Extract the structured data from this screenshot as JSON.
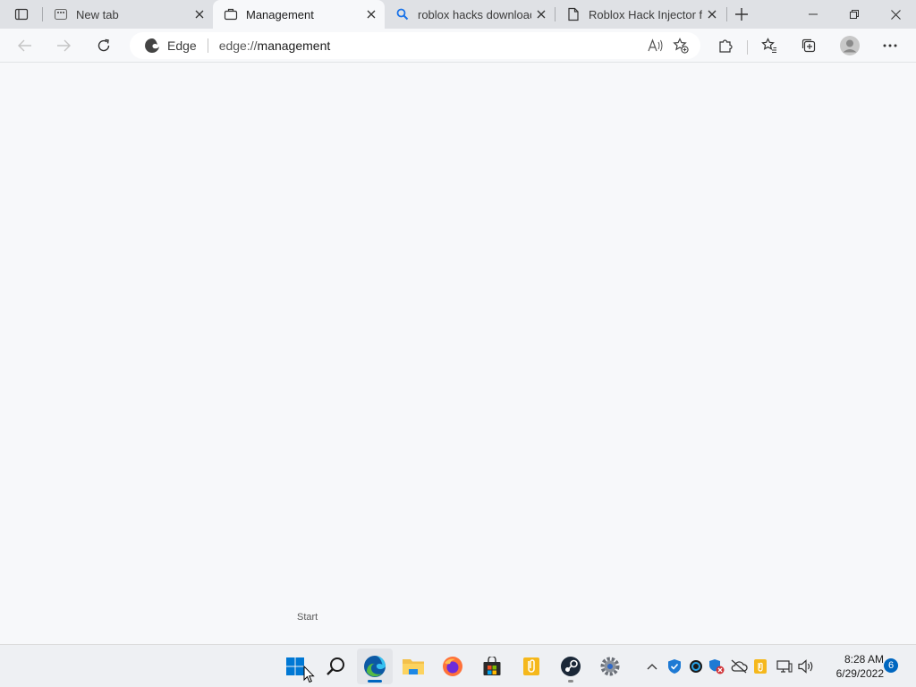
{
  "browser": {
    "tabs": [
      {
        "title": "New tab",
        "icon": "new-tab-page-icon",
        "active": false
      },
      {
        "title": "Management",
        "icon": "briefcase-icon",
        "active": true
      },
      {
        "title": "roblox hacks download",
        "icon": "search-icon",
        "active": false
      },
      {
        "title": "Roblox Hack Injector fo",
        "icon": "document-icon",
        "active": false
      }
    ],
    "address_bar": {
      "site_label": "Edge",
      "url_scheme": "edge://",
      "url_path": "management"
    }
  },
  "tooltip": {
    "text": "Start"
  },
  "taskbar": {
    "apps": [
      {
        "name": "start",
        "icon": "windows-logo-icon"
      },
      {
        "name": "search",
        "icon": "search-icon"
      },
      {
        "name": "edge",
        "icon": "edge-icon",
        "running": true,
        "active": true
      },
      {
        "name": "file-explorer",
        "icon": "folder-icon"
      },
      {
        "name": "firefox",
        "icon": "firefox-icon"
      },
      {
        "name": "store",
        "icon": "store-icon"
      },
      {
        "name": "notes",
        "icon": "notes-icon"
      },
      {
        "name": "steam",
        "icon": "steam-icon",
        "running": true
      },
      {
        "name": "settings",
        "icon": "gear-icon"
      }
    ],
    "clock": {
      "time": "8:28 AM",
      "date": "6/29/2022"
    },
    "notification_count": "6"
  },
  "colors": {
    "accent": "#0067c0",
    "tabstrip_bg": "#dfe1e5",
    "page_bg": "#f7f8fa"
  }
}
